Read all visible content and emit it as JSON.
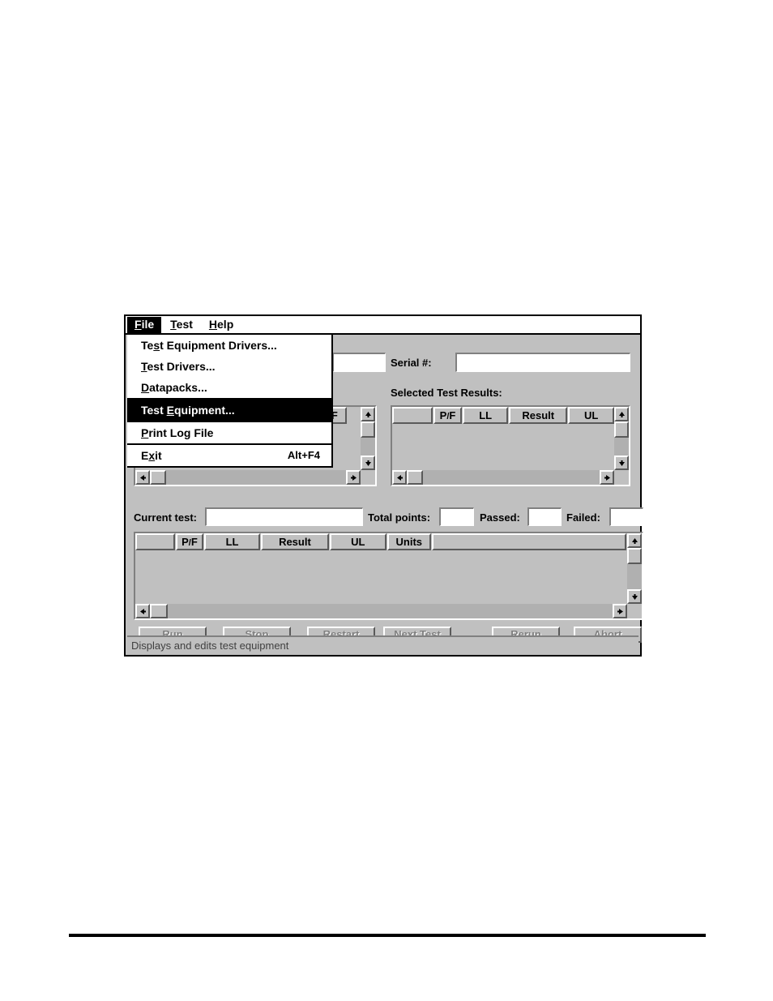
{
  "window": {
    "menubar": [
      {
        "label": "File",
        "mnemonic": "F",
        "active": true
      },
      {
        "label": "Test",
        "mnemonic": "T",
        "active": false
      },
      {
        "label": "Help",
        "mnemonic": "H",
        "active": false
      }
    ],
    "file_menu": [
      {
        "label": "Test Equipment Drivers...",
        "pre": "Te",
        "mn": "s",
        "post": "t Equipment Drivers...",
        "accel": "",
        "highlight": false,
        "separator": false
      },
      {
        "label": "Test Drivers...",
        "pre": "",
        "mn": "T",
        "post": "est Drivers...",
        "accel": "",
        "highlight": false,
        "separator": false
      },
      {
        "label": "Datapacks...",
        "pre": "",
        "mn": "D",
        "post": "atapacks...",
        "accel": "",
        "highlight": false,
        "separator": false
      },
      {
        "label": "Test Equipment...",
        "pre": "Test ",
        "mn": "E",
        "post": "quipment...",
        "accel": "",
        "highlight": true,
        "separator": true
      },
      {
        "label": "Print Log File",
        "pre": "",
        "mn": "P",
        "post": "rint Log File",
        "accel": "",
        "highlight": false,
        "separator": true
      },
      {
        "label": "Exit",
        "pre": "E",
        "mn": "x",
        "post": "it",
        "accel": "Alt+F4",
        "highlight": false,
        "separator": true
      }
    ],
    "fields": {
      "left_field_value": "",
      "serial_label": "Serial #:",
      "serial_value": "",
      "selected_results_label": "Selected Test Results:",
      "current_test_label": "Current test:",
      "current_test_value": "",
      "total_points_label": "Total points:",
      "total_points_value": "",
      "passed_label": "Passed:",
      "passed_value": "",
      "failed_label": "Failed:",
      "failed_value": ""
    },
    "left_grid": {
      "columns": [
        "",
        "P/F"
      ],
      "rows": []
    },
    "selected_results_grid": {
      "columns": [
        "",
        "P/F",
        "LL",
        "Result",
        "UL"
      ],
      "rows": []
    },
    "current_test_grid": {
      "columns": [
        "",
        "P/F",
        "LL",
        "Result",
        "UL",
        "Units",
        ""
      ],
      "rows": []
    },
    "buttons": [
      {
        "label": "Run",
        "enabled": false
      },
      {
        "label": "Stop",
        "enabled": false
      },
      {
        "label": "Restart",
        "enabled": false
      },
      {
        "label": "Next Test",
        "enabled": false
      },
      {
        "label": "Rerun",
        "enabled": false
      },
      {
        "label": "Abort",
        "enabled": false
      }
    ],
    "statusbar": {
      "text": "Displays and edits test equipment"
    },
    "scroll_icons": {
      "up": "↑",
      "down": "↓",
      "left": "←",
      "right": "→"
    }
  }
}
